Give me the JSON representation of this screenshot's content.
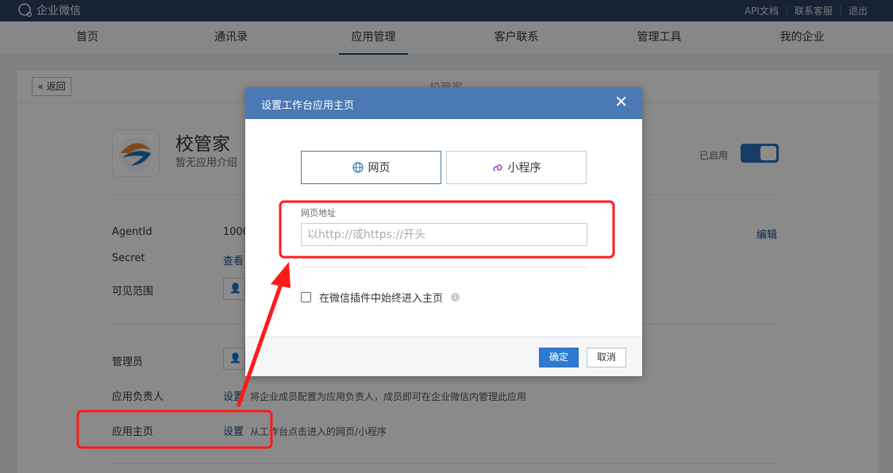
{
  "header": {
    "logo_text": "企业微信",
    "links": [
      "API文档",
      "联系客服",
      "退出"
    ]
  },
  "nav": {
    "items": [
      "首页",
      "通讯录",
      "应用管理",
      "客户联系",
      "管理工具",
      "我的企业"
    ],
    "active": "应用管理"
  },
  "page": {
    "back_label": "返回",
    "title": "校管家",
    "app_name": "校管家",
    "app_desc": "暂无应用介绍",
    "enabled_label": "已启用",
    "rows": {
      "agentid_label": "AgentId",
      "agentid_value": "1000",
      "secret_label": "Secret",
      "secret_value": "查看",
      "scope_label": "可见范围",
      "admin_label": "管理员",
      "owner_label": "应用负责人",
      "owner_link": "设置",
      "owner_desc": "将企业成员配置为应用负责人，成员即可在企业微信内管理此应用",
      "home_label": "应用主页",
      "home_link": "设置",
      "home_desc": "从工作台点击进入的网页/小程序"
    },
    "edit_label": "编辑"
  },
  "dialog": {
    "title": "设置工作台应用主页",
    "tabs": [
      "网页",
      "小程序"
    ],
    "field_label": "网页地址",
    "url_placeholder": "以http://或https://开头",
    "url_value": "",
    "checkbox_label": "在微信插件中始终进入主页",
    "ok_label": "确定",
    "cancel_label": "取消"
  },
  "colors": {
    "header_bg": "#2b3e5f",
    "dialog_header": "#4a79b4",
    "primary_button": "#2f7ad1",
    "annotation": "#ff1a1a"
  }
}
